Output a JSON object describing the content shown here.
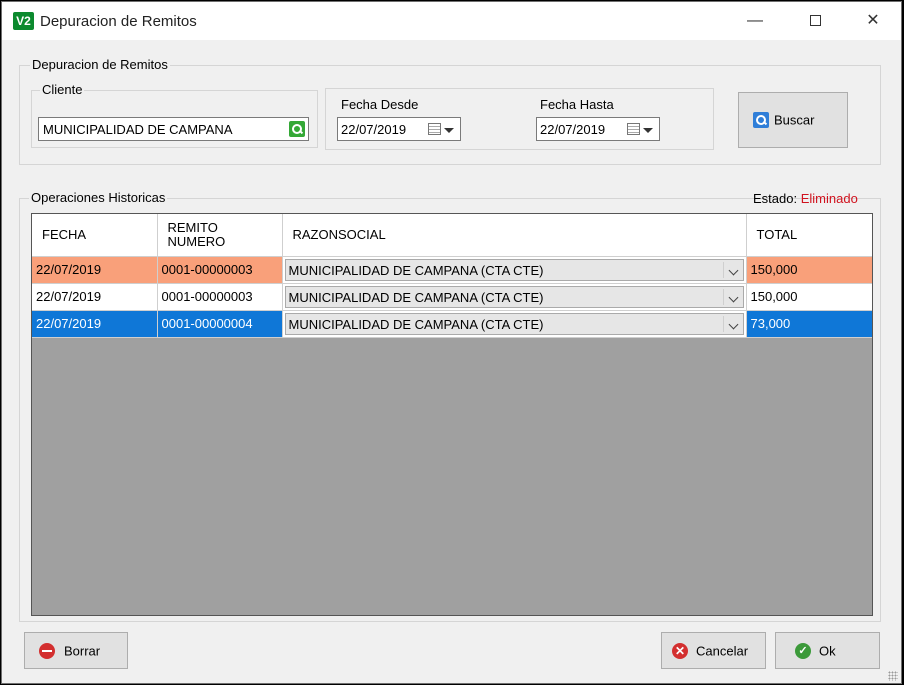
{
  "window": {
    "title": "Depuracion de Remitos",
    "logo": "V2",
    "minimize_label": "—",
    "close_label": "✕"
  },
  "filters": {
    "group_title": "Depuracion de Remitos",
    "cliente_group_title": "Cliente",
    "cliente_value": "MUNICIPALIDAD DE CAMPANA",
    "fecha_desde_label": "Fecha Desde",
    "fecha_desde_value": "22/07/2019",
    "fecha_hasta_label": "Fecha Hasta",
    "fecha_hasta_value": "22/07/2019",
    "buscar_label": "Buscar"
  },
  "operaciones": {
    "group_title": "Operaciones Historicas",
    "estado_label": "Estado:",
    "estado_value": "Eliminado",
    "estado_color": "#d0121e",
    "columns": [
      "FECHA",
      "REMITO\nNUMERO",
      "RAZONSOCIAL",
      "TOTAL"
    ],
    "rows": [
      {
        "fecha": "22/07/2019",
        "remito": "0001-00000003",
        "razonsocial": "MUNICIPALIDAD DE CAMPANA (CTA CTE)",
        "total": "150,000",
        "highlight": "salmon"
      },
      {
        "fecha": "22/07/2019",
        "remito": "0001-00000003",
        "razonsocial": "MUNICIPALIDAD DE CAMPANA (CTA CTE)",
        "total": "150,000",
        "highlight": "none"
      },
      {
        "fecha": "22/07/2019",
        "remito": "0001-00000004",
        "razonsocial": "MUNICIPALIDAD DE CAMPANA (CTA CTE)",
        "total": "73,000",
        "highlight": "selected"
      }
    ],
    "colors": {
      "salmon": "#f9a07a",
      "selected": "#0f77d7",
      "empty_area": "#a0a0a0"
    }
  },
  "footer": {
    "borrar_label": "Borrar",
    "cancelar_label": "Cancelar",
    "ok_label": "Ok"
  }
}
